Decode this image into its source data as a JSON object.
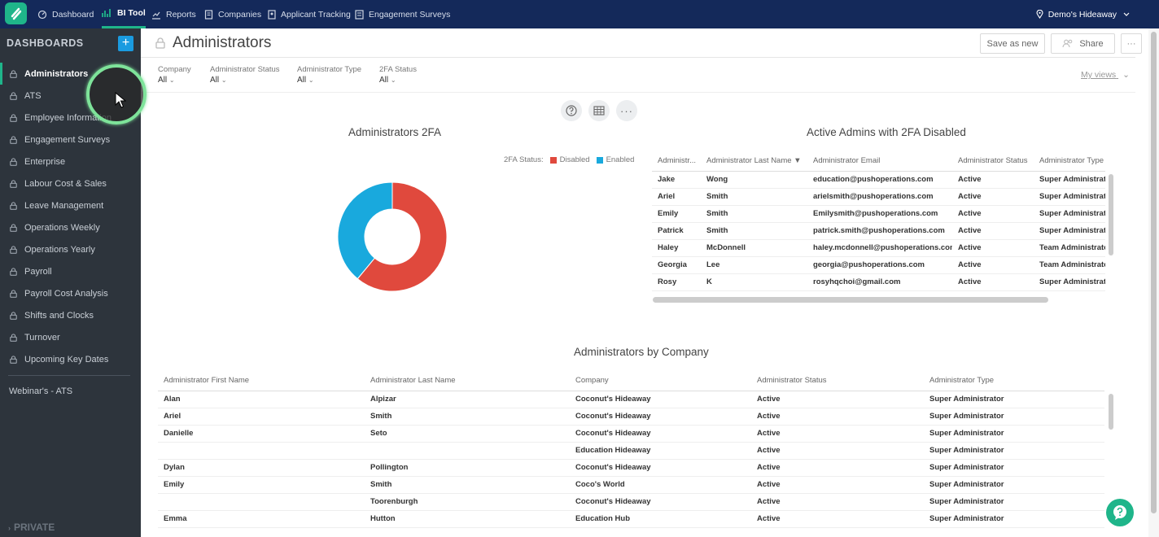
{
  "topnav": {
    "items": [
      {
        "label": "Dashboard",
        "icon": "dashboard-icon"
      },
      {
        "label": "BI Tool",
        "icon": "bi-chart-icon"
      },
      {
        "label": "Reports",
        "icon": "reports-icon"
      },
      {
        "label": "Companies",
        "icon": "companies-icon"
      },
      {
        "label": "Applicant Tracking",
        "icon": "applicant-icon"
      },
      {
        "label": "Engagement Surveys",
        "icon": "survey-icon"
      }
    ],
    "location": "Demo's Hideaway"
  },
  "sidebar": {
    "title": "DASHBOARDS",
    "add_label": "+",
    "items": [
      {
        "label": "Administrators"
      },
      {
        "label": "ATS"
      },
      {
        "label": "Employee Information"
      },
      {
        "label": "Engagement Surveys"
      },
      {
        "label": "Enterprise"
      },
      {
        "label": "Labour Cost & Sales"
      },
      {
        "label": "Leave Management"
      },
      {
        "label": "Operations Weekly"
      },
      {
        "label": "Operations Yearly"
      },
      {
        "label": "Payroll"
      },
      {
        "label": "Payroll Cost Analysis"
      },
      {
        "label": "Shifts and Clocks"
      },
      {
        "label": "Turnover"
      },
      {
        "label": "Upcoming Key Dates"
      }
    ],
    "webinar": "Webinar's - ATS",
    "private": "PRIVATE"
  },
  "header": {
    "title": "Administrators",
    "save_as_new": "Save as new",
    "share": "Share",
    "more": "···"
  },
  "filters": [
    {
      "label": "Company",
      "value": "All"
    },
    {
      "label": "Administrator Status",
      "value": "All"
    },
    {
      "label": "Administrator Type",
      "value": "All"
    },
    {
      "label": "2FA Status",
      "value": "All"
    }
  ],
  "my_views": "My views",
  "chart_data": {
    "type": "pie",
    "title": "Administrators 2FA",
    "legend_title": "2FA Status:",
    "legend_position": "top-right",
    "donut": true,
    "labels": [
      "Disabled",
      "Enabled"
    ],
    "values": [
      61,
      39
    ],
    "colors": [
      "#e0493d",
      "#19a9dd"
    ]
  },
  "table_2fa": {
    "title": "Active Admins with 2FA Disabled",
    "columns": [
      "Administr...",
      "Administrator Last Name ▼",
      "Administrator Email",
      "Administrator Status",
      "Administrator Type"
    ],
    "rows": [
      [
        "Jake",
        "Wong",
        "education@pushoperations.com",
        "Active",
        "Super Administrator"
      ],
      [
        "Ariel",
        "Smith",
        "arielsmith@pushoperations.com",
        "Active",
        "Super Administrator"
      ],
      [
        "Emily",
        "Smith",
        "Emilysmith@pushoperations.com",
        "Active",
        "Super Administrator"
      ],
      [
        "Patrick",
        "Smith",
        "patrick.smith@pushoperations.com",
        "Active",
        "Super Administrator"
      ],
      [
        "Haley",
        "McDonnell",
        "haley.mcdonnell@pushoperations.com",
        "Active",
        "Team Administrator"
      ],
      [
        "Georgia",
        "Lee",
        "georgia@pushoperations.com",
        "Active",
        "Team Administrator"
      ],
      [
        "Rosy",
        "K",
        "rosyhqchoi@gmail.com",
        "Active",
        "Super Administrator"
      ]
    ]
  },
  "table_company": {
    "title": "Administrators by Company",
    "columns": [
      "Administrator First Name",
      "Administrator Last Name",
      "Company",
      "Administrator Status",
      "Administrator Type"
    ],
    "rows": [
      [
        "Alan",
        "Alpizar",
        "Coconut's Hideaway",
        "Active",
        "Super Administrator"
      ],
      [
        "Ariel",
        "Smith",
        "Coconut's Hideaway",
        "Active",
        "Super Administrator"
      ],
      [
        "Danielle",
        "Seto",
        "Coconut's Hideaway",
        "Active",
        "Super Administrator"
      ],
      [
        "",
        "",
        "Education Hideaway",
        "Active",
        "Super Administrator"
      ],
      [
        "Dylan",
        "Pollington",
        "Coconut's Hideaway",
        "Active",
        "Super Administrator"
      ],
      [
        "Emily",
        "Smith",
        "Coco's World",
        "Active",
        "Super Administrator"
      ],
      [
        "",
        "Toorenburgh",
        "Coconut's Hideaway",
        "Active",
        "Super Administrator"
      ],
      [
        "Emma",
        "Hutton",
        "Education Hub",
        "Active",
        "Super Administrator"
      ]
    ]
  },
  "colors": {
    "nav_bg": "#14295a",
    "sidebar_bg": "#2d343c",
    "accent": "#1fb58a",
    "add_button": "#1a9be0"
  }
}
